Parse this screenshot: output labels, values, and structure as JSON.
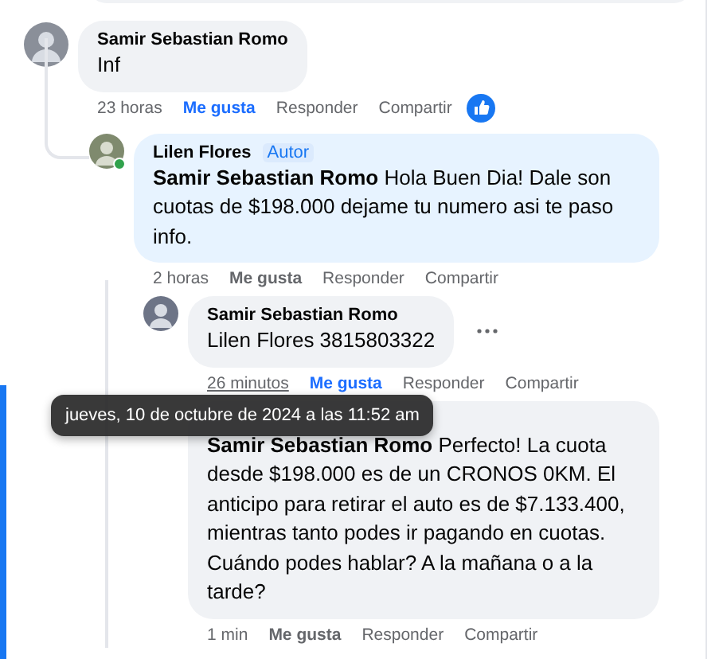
{
  "comments": [
    {
      "author": "Samir Sebastian Romo",
      "text": "Inf",
      "time": "23 horas",
      "like": "Me gusta",
      "liked": true,
      "reply": "Responder",
      "share": "Compartir",
      "reaction": true,
      "children": [
        {
          "author": "Lilen Flores",
          "badge": "Autor",
          "text": "**Samir Sebastian Romo** Hola Buen Dia! Dale son cuotas de $198.000 dejame tu numero asi te paso info.",
          "time": "2 horas",
          "like": "Me gusta",
          "liked": false,
          "reply": "Responder",
          "share": "Compartir",
          "online": true,
          "children": [
            {
              "author": "Samir Sebastian Romo",
              "text": "Lilen Flores 3815803322",
              "time": "26 minutos",
              "time_hovered": true,
              "tooltip": "jueves, 10 de octubre de 2024 a las 11:52 am",
              "like": "Me gusta",
              "liked": true,
              "reply": "Responder",
              "share": "Compartir",
              "menu": true
            },
            {
              "text": "**Samir Sebastian Romo** Perfecto! La cuota desde $198.000 es de un CRONOS 0KM. El anticipo para retirar el auto es de $7.133.400, mientras tanto podes ir pagando en cuotas. Cuándo podes hablar? A la mañana o a la tarde?",
              "time": "1 min",
              "like": "Me gusta",
              "liked": false,
              "reply": "Responder",
              "share": "Compartir"
            }
          ]
        }
      ]
    }
  ]
}
